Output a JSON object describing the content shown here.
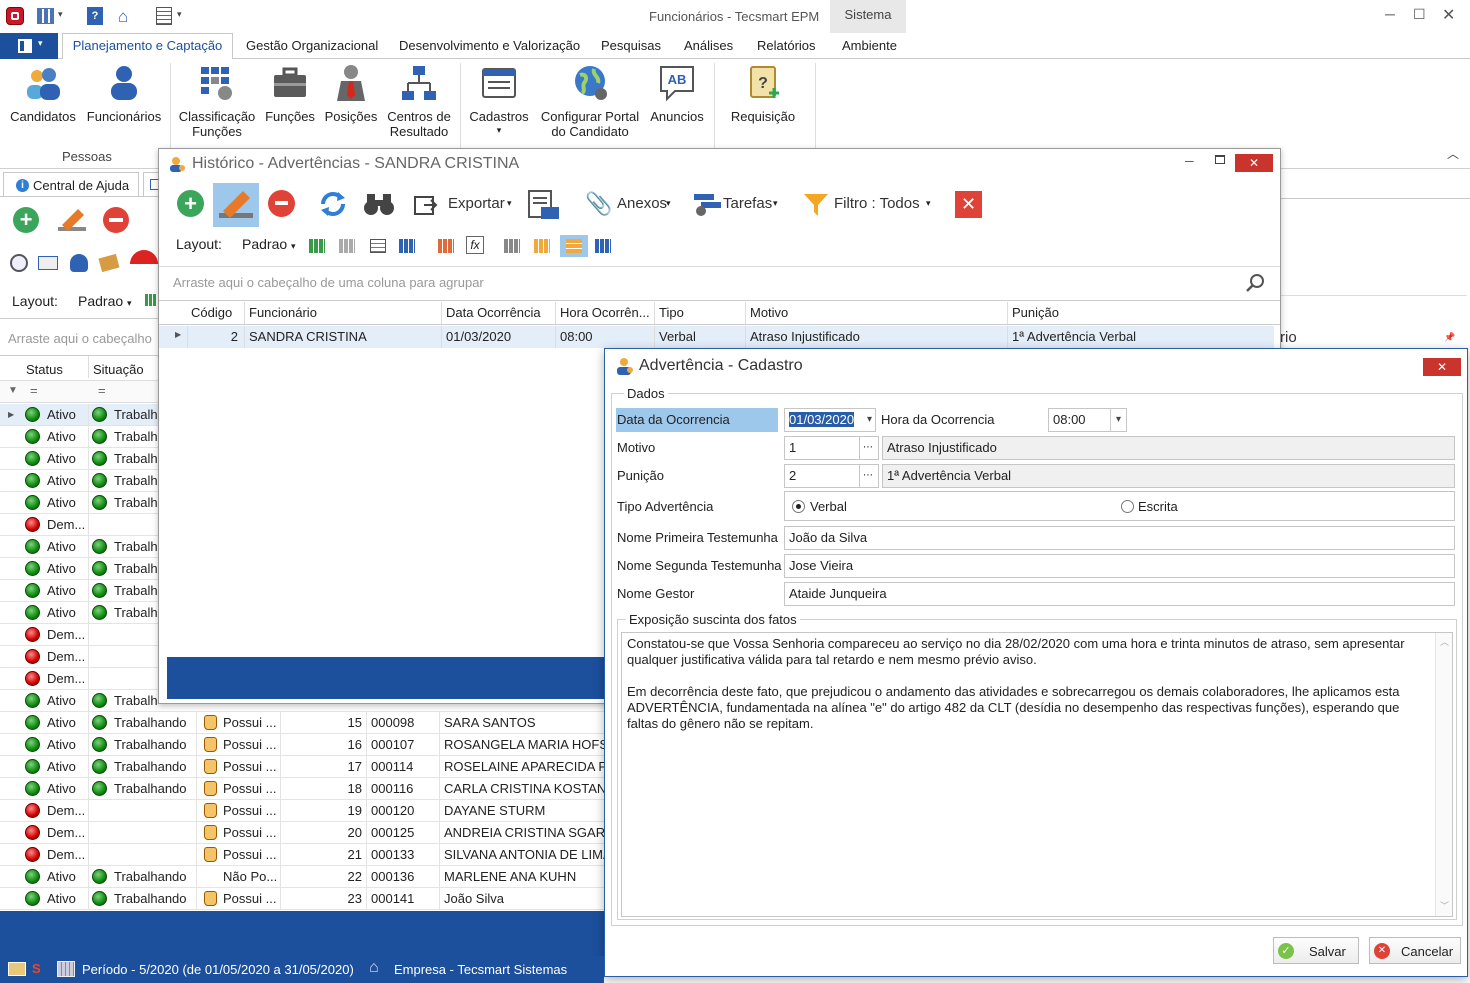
{
  "app": {
    "title": "Funcionários - Tecsmart EPM",
    "context_tab": "Sistema"
  },
  "ribbon": {
    "tabs": [
      "Planejamento e Captação",
      "Gestão Organizacional",
      "Desenvolvimento e Valorização",
      "Pesquisas",
      "Análises",
      "Relatórios",
      "Ambiente"
    ],
    "buttons": {
      "candidatos": "Candidatos",
      "funcionarios": "Funcionários",
      "classificacao1": "Classificação",
      "classificacao2": "Funções",
      "funcoes": "Funções",
      "posicoes": "Posições",
      "centros1": "Centros de",
      "centros2": "Resultado",
      "cadastros": "Cadastros",
      "cadastros_arrow": "▾",
      "configurar1": "Configurar Portal",
      "configurar2": "do Candidato",
      "anuncios": "Anuncios",
      "requisicao": "Requisição"
    },
    "group_pessoas": "Pessoas"
  },
  "left_panel": {
    "tab_help": "Central de Ajuda",
    "layout_label": "Layout:",
    "layout_value": "Padrao",
    "group_hint": "Arraste aqui o cabeçalho",
    "col_status": "Status",
    "col_situacao": "Situação",
    "filter_eq": "="
  },
  "rows": [
    {
      "status": "Ativo",
      "st": "g",
      "sit": "Trabalh",
      "sitg": true,
      "extra": null
    },
    {
      "status": "Ativo",
      "st": "g",
      "sit": "Trabalh",
      "sitg": true,
      "extra": null
    },
    {
      "status": "Ativo",
      "st": "g",
      "sit": "Trabalh",
      "sitg": true,
      "extra": null
    },
    {
      "status": "Ativo",
      "st": "g",
      "sit": "Trabalh",
      "sitg": true,
      "extra": null
    },
    {
      "status": "Ativo",
      "st": "g",
      "sit": "Trabalh",
      "sitg": true,
      "extra": null
    },
    {
      "status": "Dem...",
      "st": "r",
      "sit": "",
      "sitg": false,
      "extra": null
    },
    {
      "status": "Ativo",
      "st": "g",
      "sit": "Trabalh",
      "sitg": true,
      "extra": null
    },
    {
      "status": "Ativo",
      "st": "g",
      "sit": "Trabalh",
      "sitg": true,
      "extra": null
    },
    {
      "status": "Ativo",
      "st": "g",
      "sit": "Trabalh",
      "sitg": true,
      "extra": null
    },
    {
      "status": "Ativo",
      "st": "g",
      "sit": "Trabalh",
      "sitg": true,
      "extra": null
    },
    {
      "status": "Dem...",
      "st": "r",
      "sit": "",
      "sitg": false,
      "extra": null
    },
    {
      "status": "Dem...",
      "st": "r",
      "sit": "",
      "sitg": false,
      "extra": null
    },
    {
      "status": "Dem...",
      "st": "r",
      "sit": "",
      "sitg": false,
      "extra": null
    },
    {
      "status": "Ativo",
      "st": "g",
      "sit": "Trabalh",
      "sitg": true,
      "extra": null
    },
    {
      "status": "Ativo",
      "st": "g",
      "sit": "Trabalhando",
      "sitg": true,
      "extra": {
        "p": "Possui ...",
        "h": true,
        "n": "15",
        "c": "000098",
        "name": "SARA SANTOS"
      }
    },
    {
      "status": "Ativo",
      "st": "g",
      "sit": "Trabalhando",
      "sitg": true,
      "extra": {
        "p": "Possui ...",
        "h": true,
        "n": "16",
        "c": "000107",
        "name": "ROSANGELA MARIA HOFST..."
      }
    },
    {
      "status": "Ativo",
      "st": "g",
      "sit": "Trabalhando",
      "sitg": true,
      "extra": {
        "p": "Possui ...",
        "h": true,
        "n": "17",
        "c": "000114",
        "name": "ROSELAINE APARECIDA FR..."
      }
    },
    {
      "status": "Ativo",
      "st": "g",
      "sit": "Trabalhando",
      "sitg": true,
      "extra": {
        "p": "Possui ...",
        "h": true,
        "n": "18",
        "c": "000116",
        "name": "CARLA CRISTINA KOSTANE..."
      }
    },
    {
      "status": "Dem...",
      "st": "r",
      "sit": "",
      "sitg": false,
      "extra": {
        "p": "Possui ...",
        "h": true,
        "n": "19",
        "c": "000120",
        "name": "DAYANE STURM"
      }
    },
    {
      "status": "Dem...",
      "st": "r",
      "sit": "",
      "sitg": false,
      "extra": {
        "p": "Possui ...",
        "h": true,
        "n": "20",
        "c": "000125",
        "name": "ANDREIA CRISTINA SGARB..."
      }
    },
    {
      "status": "Dem...",
      "st": "r",
      "sit": "",
      "sitg": false,
      "extra": {
        "p": "Possui ...",
        "h": true,
        "n": "21",
        "c": "000133",
        "name": "SILVANA ANTONIA DE LIMA..."
      }
    },
    {
      "status": "Ativo",
      "st": "g",
      "sit": "Trabalhando",
      "sitg": true,
      "extra": {
        "p": "Não Po...",
        "h": false,
        "n": "22",
        "c": "000136",
        "name": "MARLENE ANA KUHN"
      }
    },
    {
      "status": "Ativo",
      "st": "g",
      "sit": "Trabalhando",
      "sitg": true,
      "extra": {
        "p": "Possui ...",
        "h": true,
        "n": "23",
        "c": "000141",
        "name": "João Silva"
      }
    }
  ],
  "historico": {
    "title": "Histórico - Advertências - SANDRA CRISTINA",
    "exportar": "Exportar",
    "anexos": "Anexos",
    "tarefas": "Tarefas",
    "filtro": "Filtro : Todos",
    "layout_label": "Layout:",
    "layout_value": "Padrao",
    "group_hint": "Arraste aqui o cabeçalho de uma coluna para agrupar",
    "columns": [
      "Código",
      "Funcionário",
      "Data Ocorrência",
      "Hora Ocorrên...",
      "Tipo",
      "Motivo",
      "Punição"
    ],
    "row": {
      "codigo": "2",
      "funcionario": "SANDRA CRISTINA",
      "data": "01/03/2020",
      "hora": "08:00",
      "tipo": "Verbal",
      "motivo": "Atraso Injustificado",
      "punicao": "1ª Advertência Verbal"
    }
  },
  "background_fragment": "rio",
  "dialog": {
    "title": "Advertência - Cadastro",
    "group": "Dados",
    "data_label": "Data da Ocorrencia",
    "data_value": "01/03/2020",
    "hora_label": "Hora da Ocorrencia",
    "hora_value": "08:00",
    "motivo_label": "Motivo",
    "motivo_code": "1",
    "motivo_desc": "Atraso Injustificado",
    "punicao_label": "Punição",
    "punicao_code": "2",
    "punicao_desc": "1ª Advertência Verbal",
    "tipo_label": "Tipo Advertência",
    "opt_verbal": "Verbal",
    "opt_escrita": "Escrita",
    "test1_label": "Nome Primeira Testemunha",
    "test1_value": "João da Silva",
    "test2_label": "Nome Segunda Testemunha",
    "test2_value": "Jose Vieira",
    "gestor_label": "Nome Gestor",
    "gestor_value": "Ataide Junqueira",
    "exposicao_label": "Exposição suscinta dos fatos",
    "exposicao_text": "Constatou-se que Vossa Senhoria compareceu ao serviço no dia 28/02/2020 com uma hora e trinta minutos de atraso, sem apresentar qualquer justificativa válida para tal retardo e nem mesmo prévio aviso.\n\nEm decorrência deste fato, que prejudicou o andamento das atividades e sobrecarregou os demais colaboradores, lhe aplicamos esta ADVERTÊNCIA, fundamentada na alínea \"e\" do artigo 482 da CLT (desídia no desempenho das respectivas funções), esperando que faltas do gênero não se repitam.",
    "salvar": "Salvar",
    "cancelar": "Cancelar"
  },
  "statusbar": {
    "periodo": "Período - 5/2020 (de 01/05/2020 a 31/05/2020)",
    "empresa": "Empresa - Tecsmart Sistemas"
  }
}
